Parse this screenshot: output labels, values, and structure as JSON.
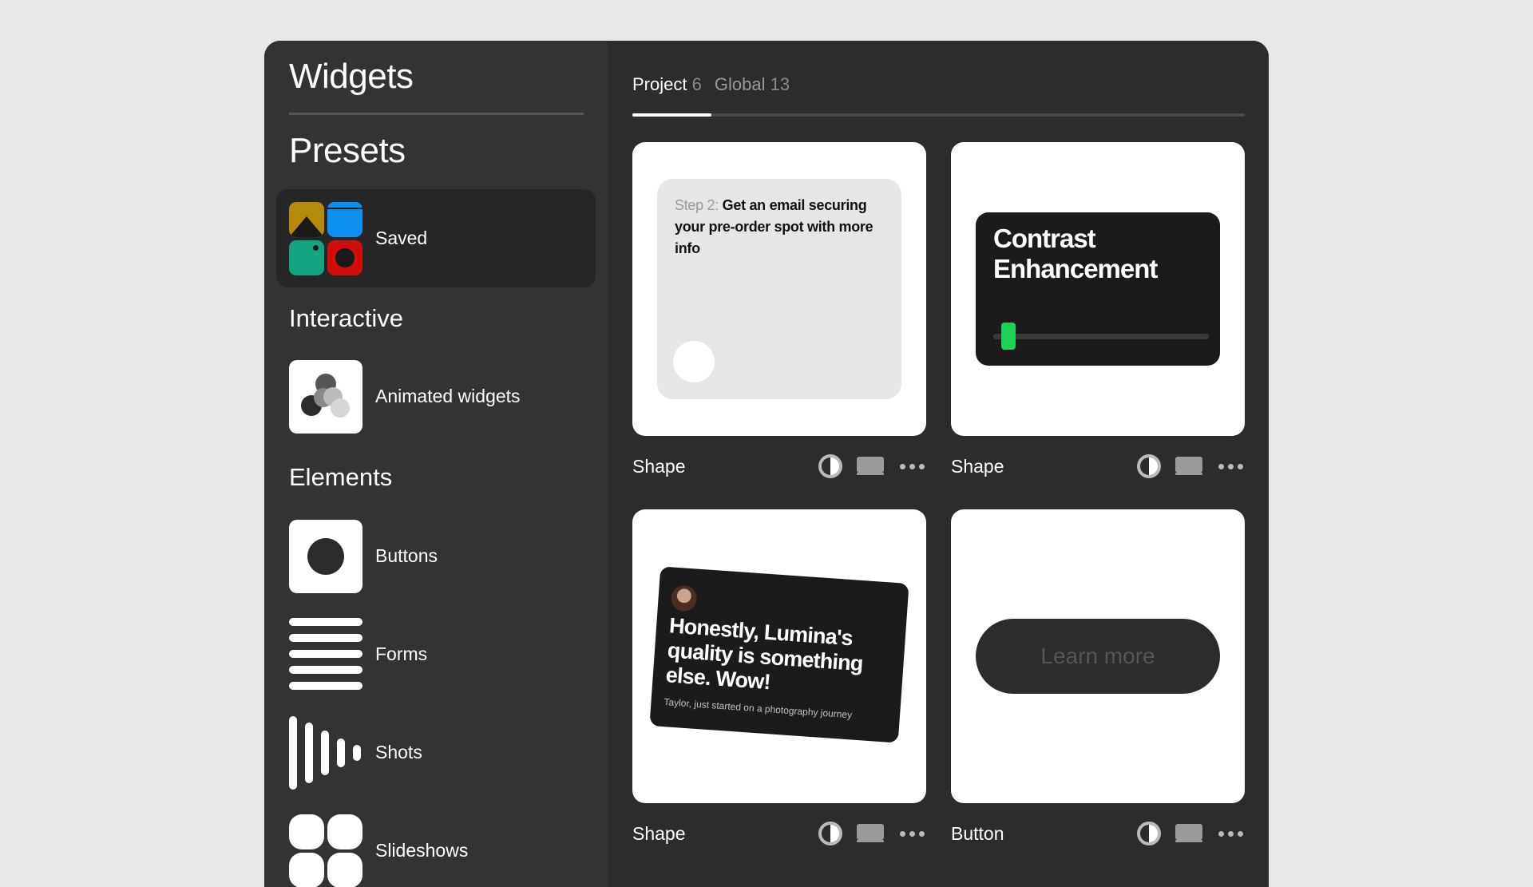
{
  "sidebar": {
    "title": "Widgets",
    "presets_title": "Presets",
    "saved_label": "Saved",
    "interactive_title": "Interactive",
    "animated_label": "Animated widgets",
    "elements_title": "Elements",
    "items": [
      {
        "label": "Buttons"
      },
      {
        "label": "Forms"
      },
      {
        "label": "Shots"
      },
      {
        "label": "Slideshows"
      }
    ]
  },
  "tabs": [
    {
      "label": "Project",
      "count": "6"
    },
    {
      "label": "Global",
      "count": "13"
    }
  ],
  "cards": [
    {
      "name": "Shape",
      "step": "Step 2:",
      "text": "Get an email securing your pre-order spot with more info"
    },
    {
      "name": "Shape",
      "title": "Contrast Enhancement"
    },
    {
      "name": "Shape",
      "quote": "Honestly, Lumina's quality is something else. Wow!",
      "sub": "Taylor, just started on a photography journey"
    },
    {
      "name": "Button",
      "button_label": "Learn more"
    }
  ],
  "colors": {
    "accent_green": "#1ed05a",
    "saved_yellow": "#b38a09",
    "saved_blue": "#0d8ff0",
    "saved_teal": "#12a57f",
    "saved_red": "#cf0e0e"
  },
  "icons": [
    "contrast-icon",
    "device-icon",
    "more-icon"
  ]
}
